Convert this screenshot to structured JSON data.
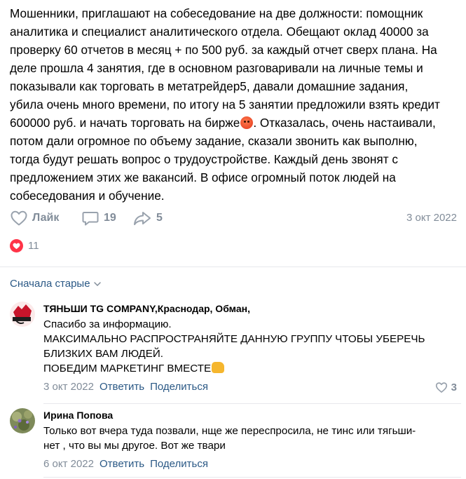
{
  "post": {
    "lines": [
      "Мошенники, приглашают на собеседование на две должности: помощник",
      "аналитика и специалист аналитического отдела. Обещают оклад 40000 за",
      "проверку 60 отчетов в месяц + по 500 руб. за каждый отчет сверх плана. На",
      "деле прошла 4 занятия, где в основном разговаривали на личные темы и",
      "показывали как торговать в метатрейдер5, давали домашние задания,",
      "убила очень много времени, по итогу на 5 занятии предложили взять кредит",
      "600000 руб. и начать торговать на бирже",
      ". Отказалась, очень настаивали,",
      "потом дали огромное по объему задание, сказали звонить как выполню,",
      "тогда будут решать вопрос о трудоустройстве. Каждый день звонят с",
      "предложением этих же вакансий. В офисе огромный поток людей на",
      "собеседования и обучение."
    ],
    "like_label": "Лайк",
    "comments_count": "19",
    "shares_count": "5",
    "date": "3 окт 2022",
    "reactions_count": "11",
    "heart_color": "#ff3347"
  },
  "comments_header": {
    "sort_label": "Сначала старые"
  },
  "comments": [
    {
      "author": "ТЯНЬШИ TG COMPANY,Краснодар, Обман,",
      "lines": [
        "Спасибо за информацию.",
        "МАКСИМАЛЬНО РАСПРОСТРАНЯЙТЕ ДАННУЮ ГРУППУ ЧТОБЫ УБЕРЕЧЬ",
        "БЛИЗКИХ ВАМ ЛЮДЕЙ.",
        "ПОБЕДИМ МАРКЕТИНГ ВМЕСТЕ"
      ],
      "date": "3 окт 2022",
      "reply_label": "Ответить",
      "share_label": "Поделиться",
      "likes": "3"
    },
    {
      "author": "Ирина Попова",
      "lines": [
        "Только вот вчера туда позвали, нще же переспросила, не тинс или тягьши-",
        "нет , что вы мы другое. Вот же твари"
      ],
      "date": "6 окт 2022",
      "reply_label": "Ответить",
      "share_label": "Поделиться"
    }
  ],
  "colors": {
    "link": "#2a5885",
    "muted": "#818c99",
    "divider": "#e7e8ec"
  }
}
